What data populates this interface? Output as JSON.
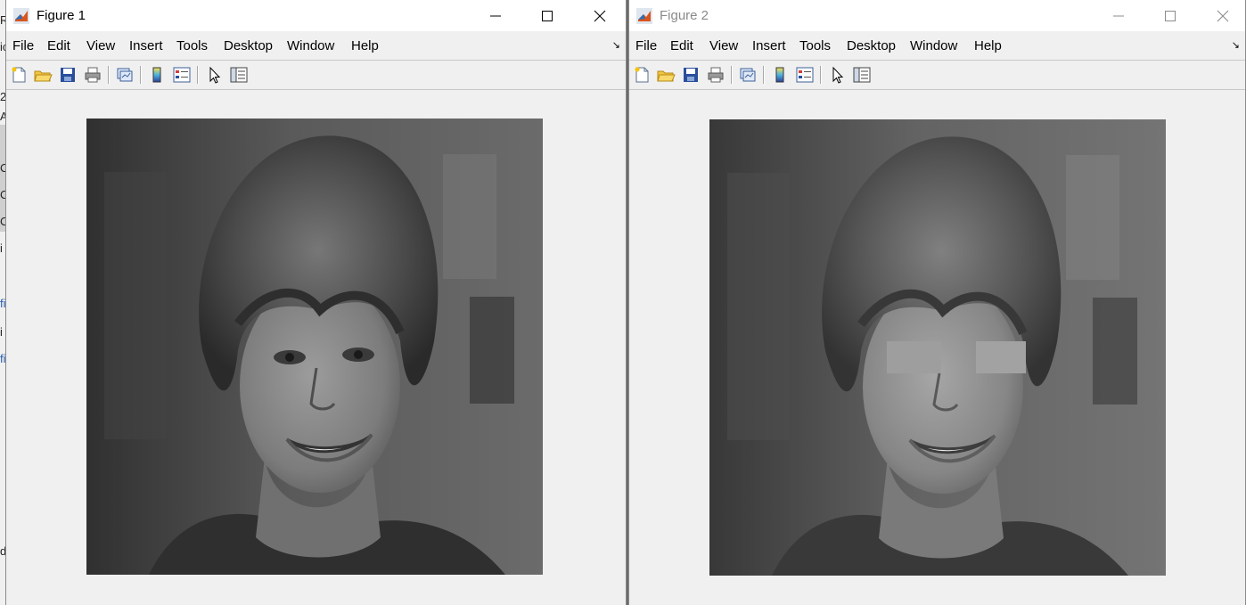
{
  "figures": [
    {
      "id": "fig1",
      "title": "Figure 1",
      "active": true,
      "menu": [
        "File",
        "Edit",
        "View",
        "Insert",
        "Tools",
        "Desktop",
        "Window",
        "Help"
      ],
      "image": {
        "eyes_masked": false
      }
    },
    {
      "id": "fig2",
      "title": "Figure 2",
      "active": false,
      "menu": [
        "File",
        "Edit",
        "View",
        "Insert",
        "Tools",
        "Desktop",
        "Window",
        "Help"
      ],
      "image": {
        "eyes_masked": true
      }
    }
  ],
  "toolbar_icons": [
    "new-figure-icon",
    "open-file-icon",
    "save-icon",
    "print-icon",
    "link-plot-icon",
    "colorbar-icon",
    "legend-icon",
    "edit-plot-arrow-icon",
    "property-inspector-icon"
  ],
  "background_fragments": [
    "Ri",
    "ic",
    "2",
    "A",
    "C",
    "C",
    "C",
    "i",
    "fi",
    "i",
    "fi",
    "d"
  ],
  "colors": {
    "accent_matlab": "#d9541e",
    "window_bg": "#f0f0f0",
    "titlebar_bg": "#ffffff"
  }
}
